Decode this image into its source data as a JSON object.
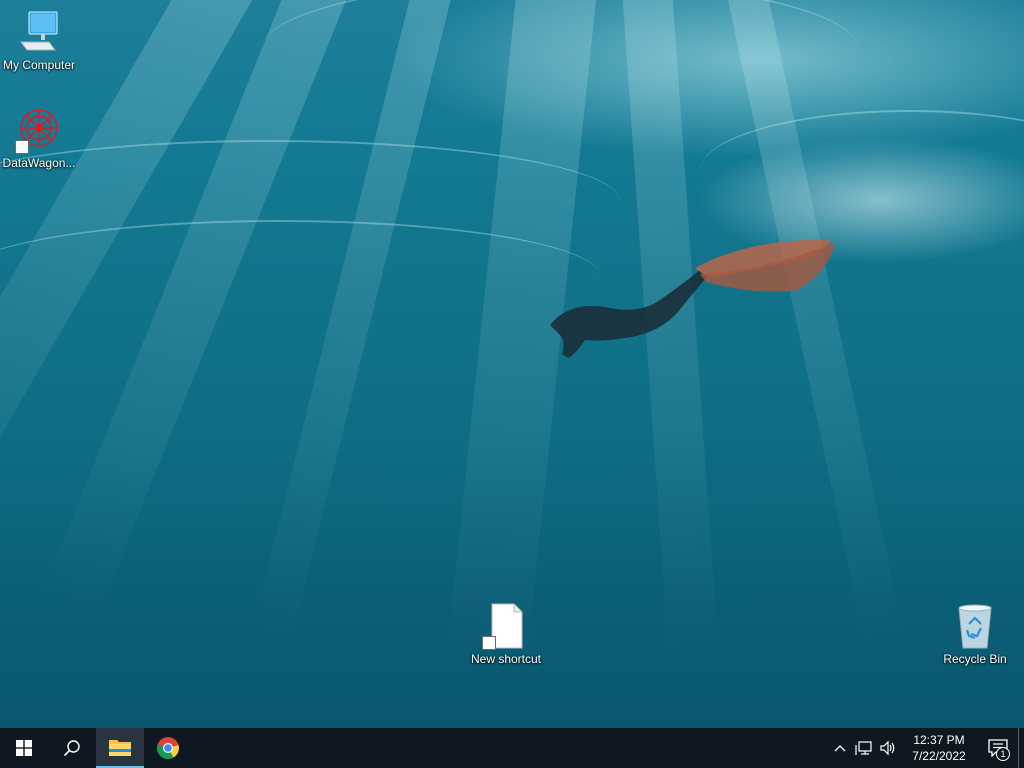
{
  "desktop": {
    "icons": [
      {
        "label": "My Computer",
        "icon": "computer-icon"
      },
      {
        "label": "DataWagon...",
        "icon": "datawagon-icon"
      },
      {
        "label": "New shortcut",
        "icon": "file-shortcut-icon"
      },
      {
        "label": "Recycle Bin",
        "icon": "recycle-bin-icon"
      }
    ]
  },
  "taskbar": {
    "start_icon": "windows-logo-icon",
    "search_icon": "search-icon",
    "pinned": [
      {
        "name": "File Explorer",
        "icon": "folder-icon",
        "active": true
      },
      {
        "name": "Google Chrome",
        "icon": "chrome-icon",
        "active": false
      }
    ],
    "tray": {
      "icons": [
        "chevron-up-icon",
        "network-icon",
        "volume-icon"
      ],
      "time": "12:37 PM",
      "date": "7/22/2022",
      "notification_count": "1"
    }
  },
  "colors": {
    "taskbar_bg": "#0f1720",
    "active_accent": "#76b9ed"
  }
}
